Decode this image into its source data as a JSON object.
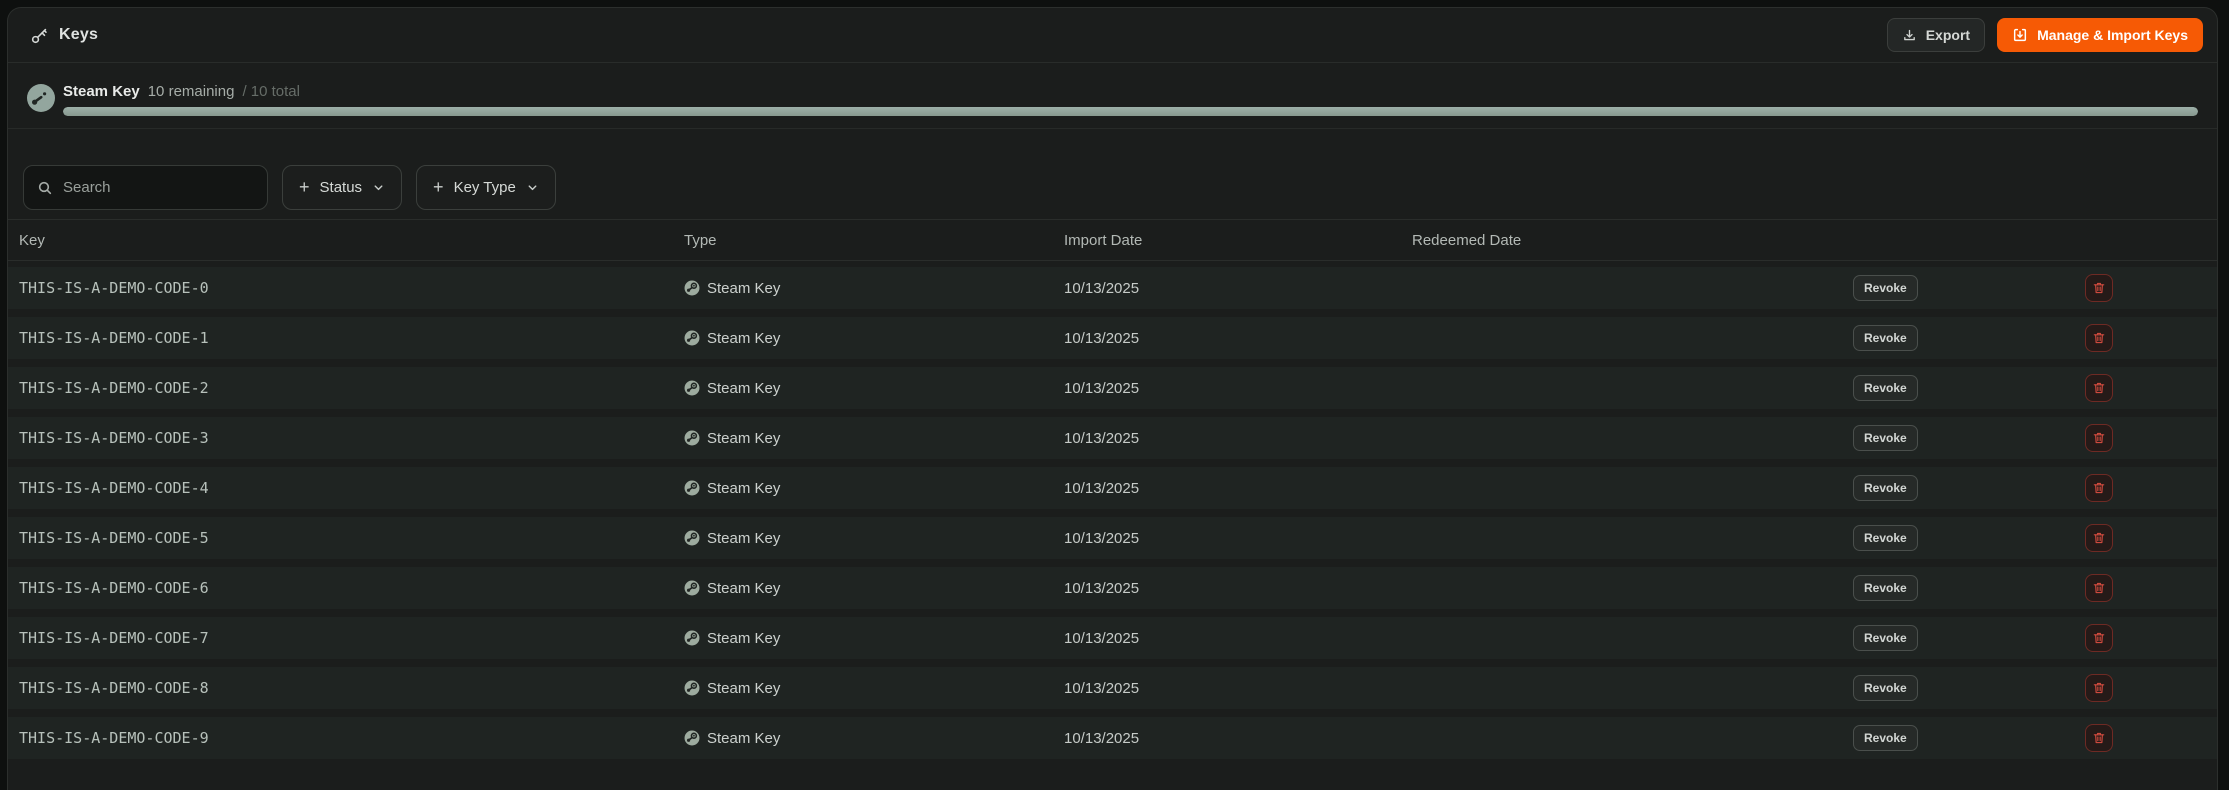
{
  "header": {
    "title": "Keys",
    "export_label": "Export",
    "manage_label": "Manage & Import Keys"
  },
  "summary": {
    "name": "Steam Key",
    "remaining_text": "10 remaining",
    "total_text": "/ 10 total",
    "progress_percent": 100
  },
  "filters": {
    "search_placeholder": "Search",
    "status_label": "Status",
    "key_type_label": "Key Type"
  },
  "table": {
    "columns": [
      "Key",
      "Type",
      "Import Date",
      "Redeemed Date"
    ],
    "rows": [
      {
        "key": "THIS-IS-A-DEMO-CODE-0",
        "type": "Steam Key",
        "import_date": "10/13/2025",
        "redeemed_date": "",
        "revoke_label": "Revoke"
      },
      {
        "key": "THIS-IS-A-DEMO-CODE-1",
        "type": "Steam Key",
        "import_date": "10/13/2025",
        "redeemed_date": "",
        "revoke_label": "Revoke"
      },
      {
        "key": "THIS-IS-A-DEMO-CODE-2",
        "type": "Steam Key",
        "import_date": "10/13/2025",
        "redeemed_date": "",
        "revoke_label": "Revoke"
      },
      {
        "key": "THIS-IS-A-DEMO-CODE-3",
        "type": "Steam Key",
        "import_date": "10/13/2025",
        "redeemed_date": "",
        "revoke_label": "Revoke"
      },
      {
        "key": "THIS-IS-A-DEMO-CODE-4",
        "type": "Steam Key",
        "import_date": "10/13/2025",
        "redeemed_date": "",
        "revoke_label": "Revoke"
      },
      {
        "key": "THIS-IS-A-DEMO-CODE-5",
        "type": "Steam Key",
        "import_date": "10/13/2025",
        "redeemed_date": "",
        "revoke_label": "Revoke"
      },
      {
        "key": "THIS-IS-A-DEMO-CODE-6",
        "type": "Steam Key",
        "import_date": "10/13/2025",
        "redeemed_date": "",
        "revoke_label": "Revoke"
      },
      {
        "key": "THIS-IS-A-DEMO-CODE-7",
        "type": "Steam Key",
        "import_date": "10/13/2025",
        "redeemed_date": "",
        "revoke_label": "Revoke"
      },
      {
        "key": "THIS-IS-A-DEMO-CODE-8",
        "type": "Steam Key",
        "import_date": "10/13/2025",
        "redeemed_date": "",
        "revoke_label": "Revoke"
      },
      {
        "key": "THIS-IS-A-DEMO-CODE-9",
        "type": "Steam Key",
        "import_date": "10/13/2025",
        "redeemed_date": "",
        "revoke_label": "Revoke"
      }
    ]
  },
  "icons": {
    "title": "key-icon",
    "export": "download-icon",
    "manage": "import-icon",
    "summary": "steam-icon",
    "search": "search-icon",
    "filter_add": "plus-icon",
    "filter_expand": "chevron-down-icon",
    "delete": "trash-icon"
  },
  "colors": {
    "accent_orange": "#f65a05",
    "progress_sage": "#93a69e",
    "danger_red": "#cf4a3e",
    "panel_bg": "#1b1d1c",
    "row_bg": "#1f2422"
  }
}
